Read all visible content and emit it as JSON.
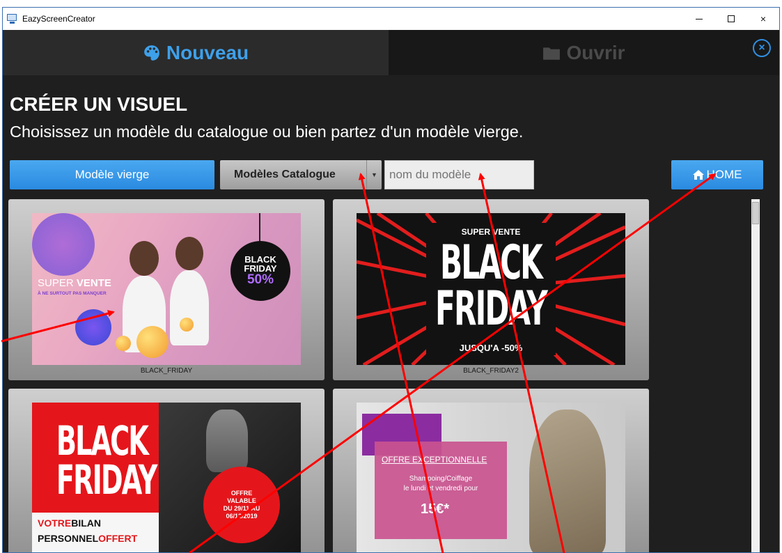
{
  "window": {
    "title": "EazyScreenCreator",
    "controls": {
      "minimize": "minimize-icon",
      "maximize": "maximize-icon",
      "close": "×"
    }
  },
  "tabs": {
    "new_label": "Nouveau",
    "open_label": "Ouvrir",
    "new_icon": "palette-icon",
    "open_icon": "folder-icon",
    "close_symbol": "×"
  },
  "page": {
    "title": "CRÉER UN VISUEL",
    "subtitle": "Choisissez un modèle du catalogue ou bien partez d'un modèle vierge."
  },
  "toolbar": {
    "blank_label": "Modèle vierge",
    "catalog_label": "Modèles Catalogue",
    "catalog_caret": "▼",
    "search_placeholder": "nom du modèle",
    "home_label": "HOME",
    "home_icon": "home-icon"
  },
  "catalog": [
    {
      "caption": "BLACK_FRIDAY",
      "badge_line1": "BLACK",
      "badge_line2": "FRIDAY",
      "badge_line3": "50%",
      "sale_light": "SUPER ",
      "sale_bold": "VENTE",
      "sale_sub": "À NE SURTOUT PAS MANQUER"
    },
    {
      "caption": "BLACK_FRIDAY2",
      "top_text": "SUPER VENTE",
      "big1": "BLACK",
      "big2": "FRIDAY",
      "bottom_text": "JUSQU'A -50%"
    },
    {
      "caption": "",
      "big1": "BLACK",
      "big2": "FRIDAY",
      "line1_a": "VOTRE",
      "line1_b": "BILAN",
      "line2_a": "PERSONNEL",
      "line2_b": "OFFERT",
      "offer1": "OFFRE",
      "offer2": "VALABLE",
      "offer3": "DU 29/11 AU",
      "offer4": "06/12/2019"
    },
    {
      "caption": "",
      "offer_title": "OFFRE EXCEPTIONNELLE",
      "line1": "Shampoing/Coiffage",
      "line2": "le lundi et vendredi pour",
      "price": "15€*"
    }
  ],
  "colors": {
    "accent_blue": "#3ea0ea",
    "annotation_red": "#ff0000",
    "background": "#1f1f1f"
  }
}
